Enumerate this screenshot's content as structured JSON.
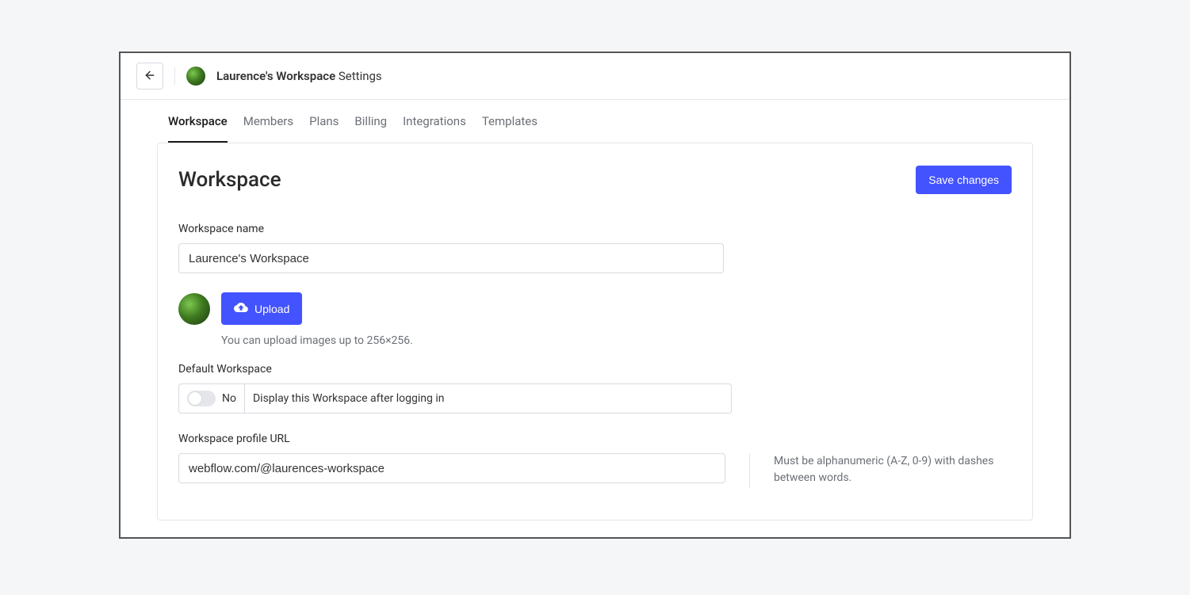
{
  "header": {
    "workspace_name": "Laurence's Workspace",
    "settings_suffix": "Settings"
  },
  "tabs": [
    {
      "label": "Workspace",
      "active": true
    },
    {
      "label": "Members",
      "active": false
    },
    {
      "label": "Plans",
      "active": false
    },
    {
      "label": "Billing",
      "active": false
    },
    {
      "label": "Integrations",
      "active": false
    },
    {
      "label": "Templates",
      "active": false
    }
  ],
  "panel": {
    "heading": "Workspace",
    "save_label": "Save changes",
    "name_label": "Workspace name",
    "name_value": "Laurence's Workspace",
    "upload_label": "Upload",
    "upload_hint": "You can upload images up to 256×256.",
    "default_label": "Default Workspace",
    "toggle_state": "No",
    "toggle_desc": "Display this Workspace after logging in",
    "url_label": "Workspace profile URL",
    "url_value": "webflow.com/@laurences-workspace",
    "url_hint": "Must be alphanumeric (A-Z, 0-9) with dashes between words."
  },
  "colors": {
    "primary": "#4353ff"
  }
}
